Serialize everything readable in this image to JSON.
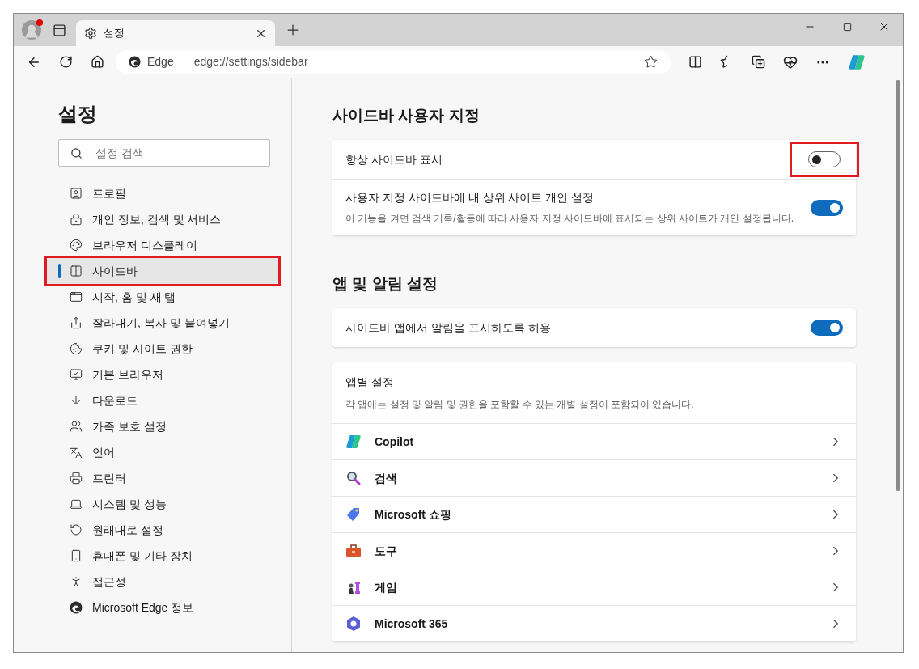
{
  "browser": {
    "tab": {
      "title": "설정"
    },
    "address": {
      "site_label": "Edge",
      "url": "edge://settings/sidebar"
    }
  },
  "sidebar": {
    "title": "설정",
    "search": {
      "placeholder": "설정 검색"
    },
    "items": [
      {
        "label": "프로필",
        "selected": false,
        "highlighted": false
      },
      {
        "label": "개인 정보, 검색 및 서비스",
        "selected": false,
        "highlighted": false
      },
      {
        "label": "브라우저 디스플레이",
        "selected": false,
        "highlighted": false
      },
      {
        "label": "사이드바",
        "selected": true,
        "highlighted": true
      },
      {
        "label": "시작, 홈 및 새 탭",
        "selected": false,
        "highlighted": false
      },
      {
        "label": "잘라내기, 복사 및 붙여넣기",
        "selected": false,
        "highlighted": false
      },
      {
        "label": "쿠키 및 사이트 권한",
        "selected": false,
        "highlighted": false
      },
      {
        "label": "기본 브라우저",
        "selected": false,
        "highlighted": false
      },
      {
        "label": "다운로드",
        "selected": false,
        "highlighted": false
      },
      {
        "label": "가족 보호 설정",
        "selected": false,
        "highlighted": false
      },
      {
        "label": "언어",
        "selected": false,
        "highlighted": false
      },
      {
        "label": "프린터",
        "selected": false,
        "highlighted": false
      },
      {
        "label": "시스템 및 성능",
        "selected": false,
        "highlighted": false
      },
      {
        "label": "원래대로 설정",
        "selected": false,
        "highlighted": false
      },
      {
        "label": "휴대폰 및 기타 장치",
        "selected": false,
        "highlighted": false
      },
      {
        "label": "접근성",
        "selected": false,
        "highlighted": false
      },
      {
        "label": "Microsoft Edge 정보",
        "selected": false,
        "highlighted": false
      }
    ]
  },
  "sections": [
    {
      "heading": "사이드바 사용자 지정",
      "settings": [
        {
          "label": "항상 사이드바 표시",
          "on": false,
          "highlighted": true
        },
        {
          "label": "사용자 지정 사이드바에 내 상위 사이트 개인 설정",
          "description": "이 기능을 켜면 검색 기록/활동에 따라 사용자 지정 사이드바에 표시되는 상위 사이트가 개인 설정됩니다.",
          "on": true,
          "highlighted": false
        }
      ]
    },
    {
      "heading": "앱 및 알림 설정",
      "settings": [
        {
          "label": "사이드바 앱에서 알림을 표시하도록 허용",
          "on": true,
          "highlighted": false
        }
      ]
    }
  ],
  "app_settings": {
    "title": "앱별 설정",
    "description": "각 앱에는 설정 및 알림 및 권한을 포함할 수 있는 개별 설정이 포함되어 있습니다.",
    "apps": [
      {
        "label": "Copilot"
      },
      {
        "label": "검색"
      },
      {
        "label": "Microsoft 쇼핑"
      },
      {
        "label": "도구"
      },
      {
        "label": "게임"
      },
      {
        "label": "Microsoft 365"
      }
    ]
  }
}
